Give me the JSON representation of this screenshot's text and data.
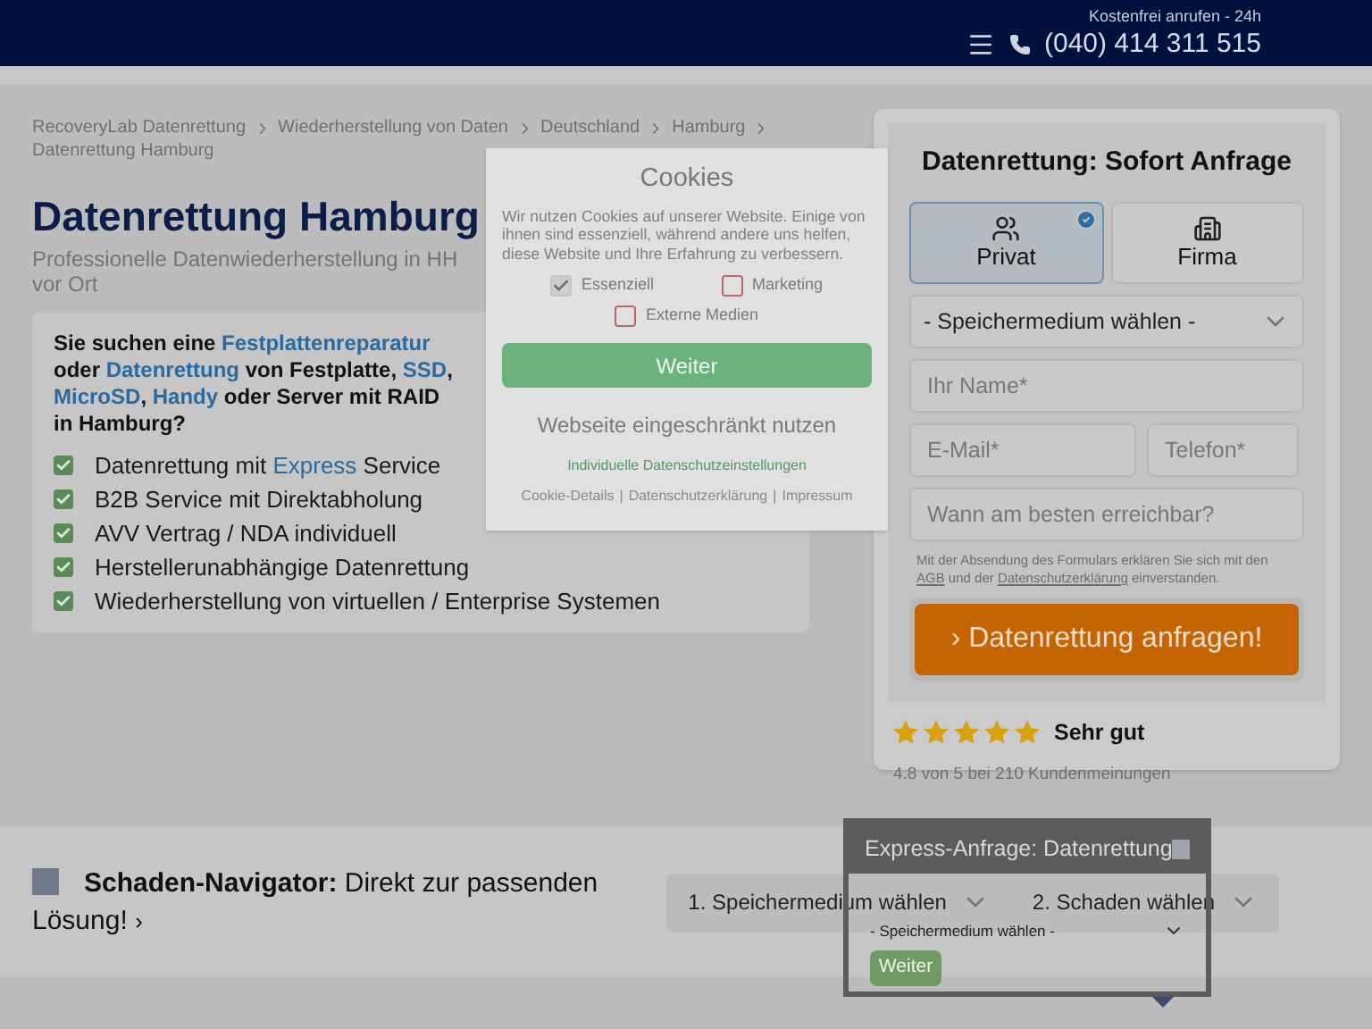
{
  "header": {
    "hotline_label": "Kostenfrei anrufen - 24h",
    "phone": "(040) 414 311 515"
  },
  "breadcrumb": [
    "RecoveryLab Datenrettung",
    "Wiederherstellung von Daten",
    "Deutschland",
    "Hamburg",
    "Datenrettung Hamburg"
  ],
  "title": "Datenrettung Hamburg",
  "subtitle": "Professionelle Datenwiederherstellung in HH vor Ort",
  "info_box": {
    "heading": [
      {
        "text": "Sie suchen eine ",
        "kind": "text"
      },
      {
        "text": "Festplattenreparatur",
        "kind": "link"
      },
      {
        "text": " oder ",
        "kind": "text"
      },
      {
        "text": "Datenrettung",
        "kind": "link"
      },
      {
        "text": " von Festplatte, ",
        "kind": "text"
      },
      {
        "text": "SSD",
        "kind": "link"
      },
      {
        "text": ", ",
        "kind": "text"
      },
      {
        "text": "MicroSD",
        "kind": "link"
      },
      {
        "text": ", ",
        "kind": "text"
      },
      {
        "text": "Handy",
        "kind": "link"
      },
      {
        "text": " oder Server mit RAID in Hamburg?",
        "kind": "text"
      }
    ],
    "items": [
      [
        {
          "text": "Datenrettung mit ",
          "kind": "text"
        },
        {
          "text": "Express",
          "kind": "link"
        },
        {
          "text": " Service",
          "kind": "text"
        }
      ],
      [
        {
          "text": "B2B Service mit Direktabholung",
          "kind": "text"
        }
      ],
      [
        {
          "text": "AVV Vertrag / NDA individuell",
          "kind": "text"
        }
      ],
      [
        {
          "text": "Herstellerunabhängige Datenrettung",
          "kind": "text"
        }
      ],
      [
        {
          "text": "Wiederherstellung von virtuellen / Enterprise Systemen",
          "kind": "text"
        }
      ]
    ]
  },
  "form": {
    "title": "Datenrettung: Sofort Anfrage",
    "customer_types": [
      {
        "label": "Privat",
        "kind": "people",
        "selected": true
      },
      {
        "label": "Firma",
        "kind": "building",
        "selected": false
      }
    ],
    "medium_select": "- Speichermedium wählen -",
    "name_placeholder": "Ihr Name*",
    "email_placeholder": "E-Mail*",
    "phone_placeholder": "Telefon*",
    "reach_placeholder": "Wann am besten erreichbar?",
    "consent": [
      {
        "text": "Mit der Absendung des Formulars erklären Sie sich mit den ",
        "kind": "text"
      },
      {
        "text": "AGB",
        "kind": "link"
      },
      {
        "text": " und der ",
        "kind": "text"
      },
      {
        "text": "Datenschutzerklärung",
        "kind": "link"
      },
      {
        "text": " einverstanden.",
        "kind": "text"
      }
    ],
    "submit": "› Datenrettung anfragen!",
    "rating": {
      "stars": 5,
      "label": "Sehr gut",
      "summary": "4.8 von 5 bei 210 Kundenmeinungen"
    }
  },
  "navigator": {
    "title": "Schaden-Navigator:",
    "text": " Direkt zur passenden Lösung!",
    "chevron": "›",
    "selects": [
      "1. Speichermedium wählen",
      "2. Schaden wählen"
    ]
  },
  "cookie_dialog": {
    "title": "Cookies",
    "text": "Wir nutzen Cookies auf unserer Website. Einige von ihnen sind essenziell, während andere uns helfen, diese Website und Ihre Erfahrung zu verbessern.",
    "options": [
      {
        "label": "Essenziell",
        "checked": true,
        "disabled": true
      },
      {
        "label": "Marketing",
        "checked": false,
        "disabled": false
      },
      {
        "label": "Externe Medien",
        "checked": false,
        "disabled": false
      }
    ],
    "accept": "Weiter",
    "restrict": "Webseite eingeschränkt nutzen",
    "individual": "Individuelle Datenschutzeinstellungen",
    "footer_links": [
      "Cookie-Details",
      "Datenschutzerklärung",
      "Impressum"
    ],
    "separator": "|"
  },
  "express_popup": {
    "title": "Express-Anfrage: Datenrettung",
    "select": "- Speichermedium wählen -",
    "button": "Weiter"
  }
}
